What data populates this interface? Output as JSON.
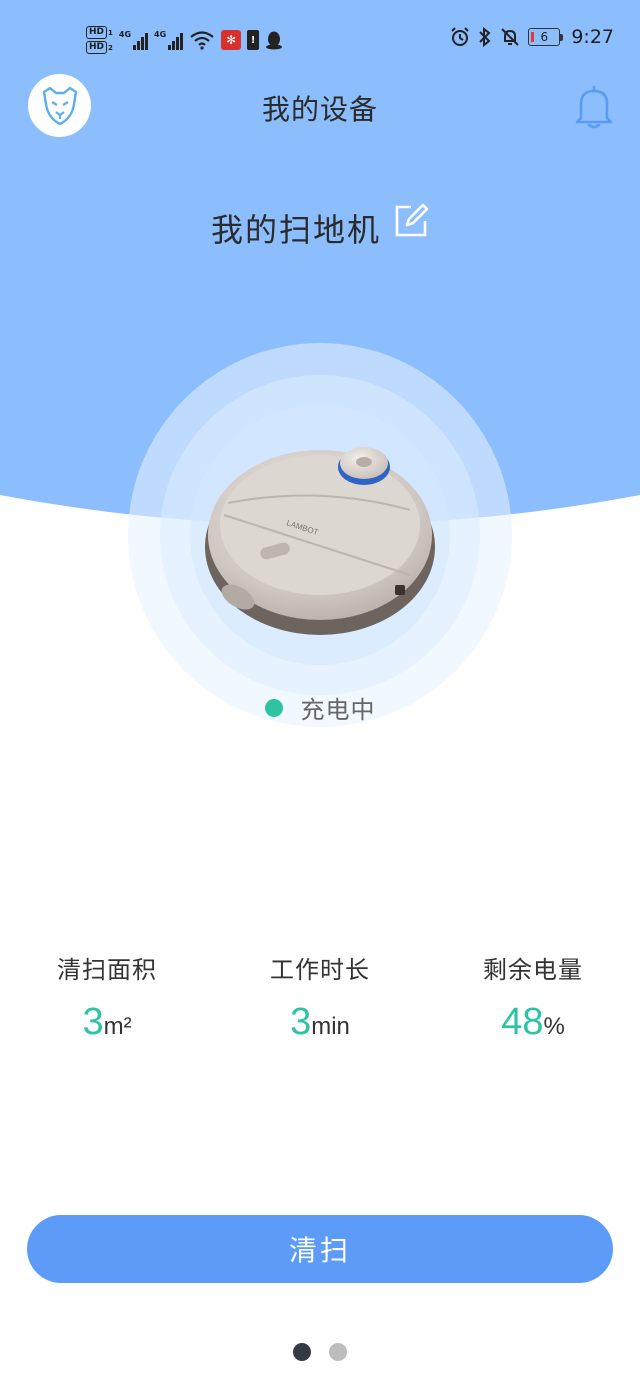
{
  "status_bar": {
    "hd1": "HD",
    "hd1_num": "1",
    "hd2": "HD",
    "hd2_num": "2",
    "net1": "4G",
    "net2": "4G",
    "battery_level": "6",
    "time": "9:27"
  },
  "header": {
    "title": "我的设备",
    "avatar_icon": "panther-logo-icon",
    "bell_icon": "bell-icon"
  },
  "device": {
    "name": "我的扫地机",
    "edit_icon": "edit-icon",
    "robot_brand": "LAMBOT",
    "status_text": "充电中",
    "status_color": "#2ec4a3"
  },
  "stats": [
    {
      "label": "清扫面积",
      "value": "3",
      "unit": "m²"
    },
    {
      "label": "工作时长",
      "value": "3",
      "unit": "min"
    },
    {
      "label": "剩余电量",
      "value": "48",
      "unit": "%"
    }
  ],
  "actions": {
    "clean_label": "清扫"
  },
  "pager": {
    "active_index": 0,
    "count": 2
  },
  "colors": {
    "hero_blue": "#8cbdfc",
    "accent_teal": "#2ec4a3",
    "button_blue": "#5c9cf8",
    "bell_blue": "#5b9bf0",
    "dot_active": "#333a44",
    "dot_inactive": "#bdbdbd"
  }
}
